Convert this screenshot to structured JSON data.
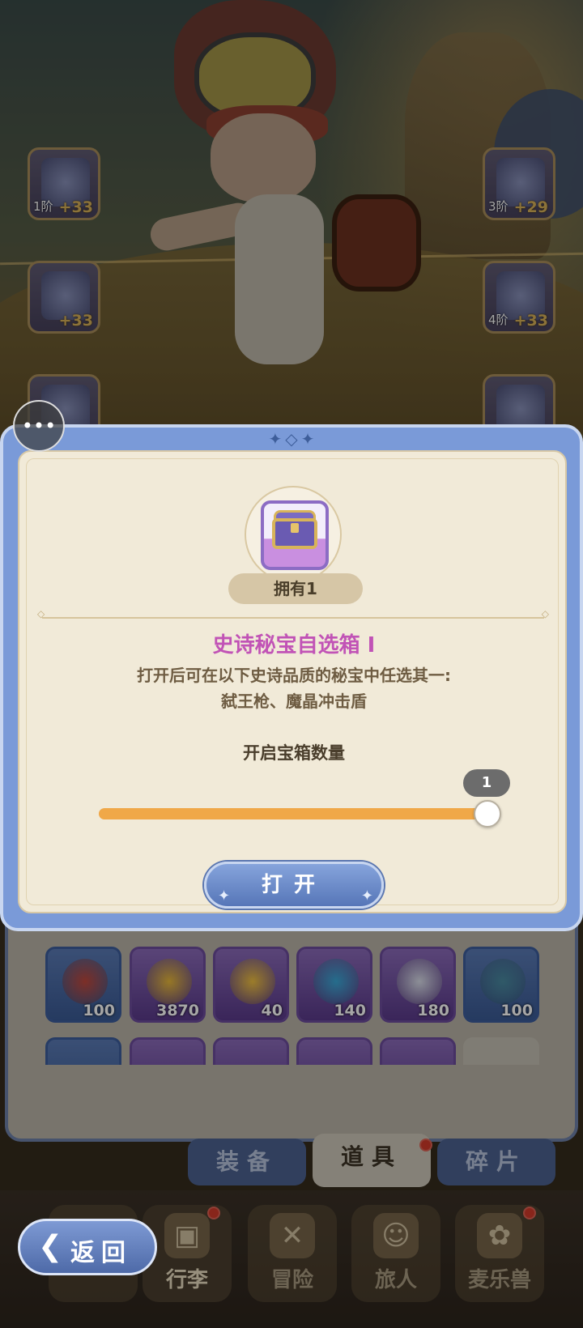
{
  "equipment_slots": [
    {
      "name": "weapon-slot",
      "tier": "1阶",
      "plus": "+33"
    },
    {
      "name": "armor-slot",
      "tier": "",
      "plus": "+33"
    },
    {
      "name": "boots-slot",
      "tier": "",
      "plus": ""
    },
    {
      "name": "helmet-slot",
      "tier": "3阶",
      "plus": "+29"
    },
    {
      "name": "shoulder-slot",
      "tier": "4阶",
      "plus": "+33"
    },
    {
      "name": "accessory-slot",
      "tier": "",
      "plus": ""
    }
  ],
  "modal": {
    "owned_label": "拥有1",
    "item_title": "史诗秘宝自选箱 I",
    "description_line1": "打开后可在以下史诗品质的秘宝中任选其一:",
    "description_line2": "弑王枪、魔晶冲击盾",
    "quantity_label": "开启宝箱数量",
    "quantity_value": "1",
    "slider_fraction": 1.0,
    "open_button_label": "打开"
  },
  "inventory": [
    {
      "count": "100",
      "rarity": "blue",
      "color": "#c0483c"
    },
    {
      "count": "3870",
      "rarity": "purple",
      "color": "#e8b83a"
    },
    {
      "count": "40",
      "rarity": "purple",
      "color": "#f0c040"
    },
    {
      "count": "140",
      "rarity": "purple",
      "color": "#3aa8d8"
    },
    {
      "count": "180",
      "rarity": "purple",
      "color": "#d8dce8"
    },
    {
      "count": "100",
      "rarity": "blue",
      "color": "#4a8aa0"
    }
  ],
  "tabs": [
    {
      "label": "装备",
      "active": false
    },
    {
      "label": "道具",
      "active": true
    },
    {
      "label": "碎片",
      "active": false
    }
  ],
  "bottom_nav": [
    {
      "label": "行李",
      "icon": "▣"
    },
    {
      "label": "冒险",
      "icon": "✕"
    },
    {
      "label": "旅人",
      "icon": "☺"
    },
    {
      "label": "麦乐兽",
      "icon": "✿"
    }
  ],
  "back_button": {
    "label": "返回",
    "icon": "❮"
  },
  "colors": {
    "modal_frame": "#7a9ad8",
    "modal_body": "#f1ead8",
    "title_purple": "#c153b6",
    "slider_fill": "#f0a848",
    "button_blue": "#5676b8"
  }
}
